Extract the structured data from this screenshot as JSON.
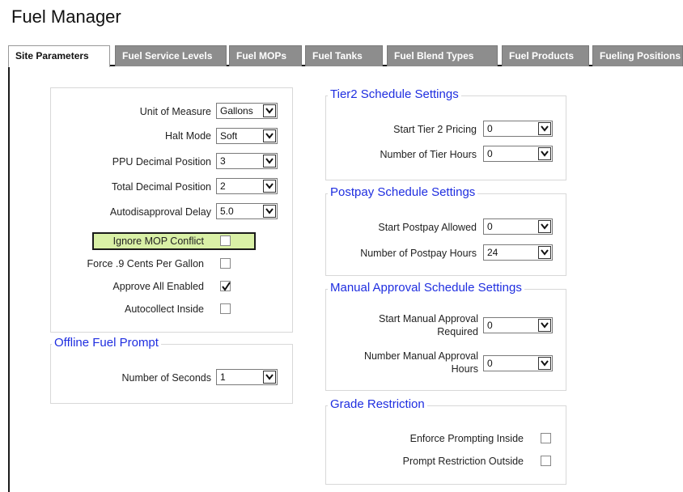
{
  "header": {
    "title": "Fuel Manager"
  },
  "tabs": [
    {
      "label": "Site Parameters",
      "active": true
    },
    {
      "label": "Fuel Service Levels",
      "active": false
    },
    {
      "label": "Fuel MOPs",
      "active": false
    },
    {
      "label": "Fuel Tanks",
      "active": false
    },
    {
      "label": "Fuel Blend Types",
      "active": false
    },
    {
      "label": "Fuel Products",
      "active": false
    },
    {
      "label": "Fueling Positions",
      "active": false
    }
  ],
  "site_settings": {
    "unit_of_measure": {
      "label": "Unit of Measure",
      "value": "Gallons"
    },
    "halt_mode": {
      "label": "Halt Mode",
      "value": "Soft"
    },
    "ppu_decimal": {
      "label": "PPU Decimal Position",
      "value": "3"
    },
    "total_decimal": {
      "label": "Total Decimal Position",
      "value": "2"
    },
    "autodisapproval_delay": {
      "label": "Autodisapproval Delay",
      "value": "5.0"
    },
    "ignore_mop_conflict": {
      "label": "Ignore MOP Conflict",
      "checked": false
    },
    "force_9_cents": {
      "label": "Force .9 Cents Per Gallon",
      "checked": false
    },
    "approve_all_enabled": {
      "label": "Approve All Enabled",
      "checked": true
    },
    "autocollect_inside": {
      "label": "Autocollect Inside",
      "checked": false
    }
  },
  "offline_fuel_prompt": {
    "title": "Offline Fuel Prompt",
    "number_of_seconds": {
      "label": "Number of Seconds",
      "value": "1"
    }
  },
  "tier2_schedule": {
    "title": "Tier2 Schedule Settings",
    "start_tier2_pricing": {
      "label": "Start Tier 2 Pricing",
      "value": "0"
    },
    "number_of_tier_hours": {
      "label": "Number of Tier Hours",
      "value": "0"
    }
  },
  "postpay_schedule": {
    "title": "Postpay Schedule Settings",
    "start_postpay_allowed": {
      "label": "Start Postpay Allowed",
      "value": "0"
    },
    "number_of_postpay_hours": {
      "label": "Number of Postpay Hours",
      "value": "24"
    }
  },
  "manual_approval_schedule": {
    "title": "Manual Approval Schedule Settings",
    "start_manual_approval": {
      "label": "Start Manual Approval Required",
      "value": "0"
    },
    "number_manual_approval_hours": {
      "label": "Number Manual Approval Hours",
      "value": "0"
    }
  },
  "grade_restriction": {
    "title": "Grade Restriction",
    "enforce_prompting_inside": {
      "label": "Enforce Prompting Inside",
      "checked": false
    },
    "prompt_restriction_outside": {
      "label": "Prompt Restriction Outside",
      "checked": false
    }
  },
  "colors": {
    "legend_blue": "#1f2ee0",
    "tab_inactive": "#8d8d8d",
    "highlight_green": "#d9f0a6"
  },
  "icons": {
    "dropdown": "chevron-down-icon",
    "checkmark": "checkmark-icon"
  }
}
